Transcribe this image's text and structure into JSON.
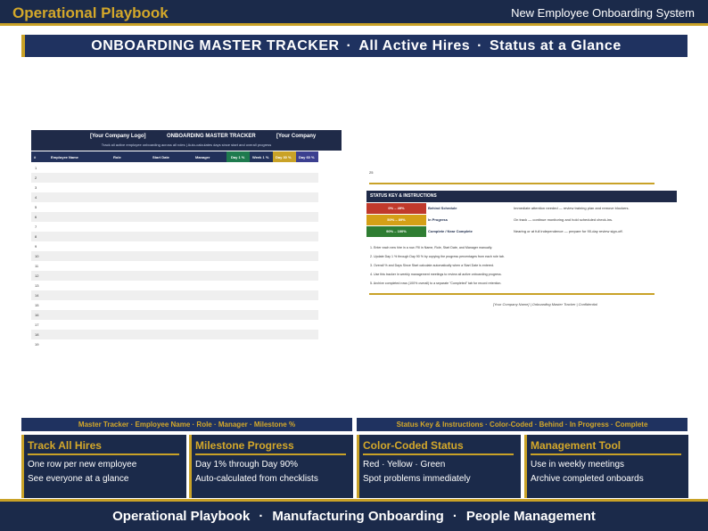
{
  "header": {
    "brand": "Operational Playbook",
    "system": "New Employee Onboarding System"
  },
  "banner": {
    "part1": "ONBOARDING MASTER TRACKER",
    "sep": "·",
    "part2": "All Active Hires",
    "part3": "Status at a Glance"
  },
  "sheet": {
    "logo_left": "[Your Company Logo]",
    "title": "ONBOARDING MASTER TRACKER",
    "logo_right": "[Your Company",
    "subtitle": "Track all active employee onboarding across all roles  |  Auto-calculates days since start and overall progress",
    "columns": [
      "#",
      "Employee Name",
      "Role",
      "Start Date",
      "Manager",
      "Day 1 %",
      "Week 1 %",
      "Day 30 %",
      "Day 60 %"
    ],
    "row_numbers": [
      "1",
      "2",
      "3",
      "4",
      "5",
      "6",
      "7",
      "8",
      "9",
      "10",
      "11",
      "12",
      "13",
      "14",
      "15",
      "16",
      "17",
      "18",
      "19"
    ]
  },
  "status_key": {
    "year": "25",
    "header": "STATUS KEY & INSTRUCTIONS",
    "rows": [
      {
        "range": "0% – 49%",
        "name": "Behind Schedule",
        "desc": "Immediate attention needed — review training plan and remove blockers.",
        "color": "#c0392b"
      },
      {
        "range": "50% – 89%",
        "name": "In Progress",
        "desc": "On track — continue monitoring and hold scheduled check-ins.",
        "color": "#d4a017"
      },
      {
        "range": "90% – 100%",
        "name": "Complete / Near Complete",
        "desc": "Nearing or at full independence — prepare for 90-day review sign-off.",
        "color": "#2e7d32"
      }
    ],
    "instructions": [
      "1.  Enter each new hire in a row. Fill in Name, Role, Start Date, and Manager manually.",
      "2.  Update Day 1 % through Day 90 % by copying the progress percentages from each role tab.",
      "3.  Overall % and Days Since Start calculate automatically when a Start Date is entered.",
      "4.  Use this tracker in weekly management meetings to review all active onboarding progress.",
      "5.  Archive completed rows (100% overall) to a separate \"Completed\" tab for record retention."
    ],
    "footer": "[Your Company Name]  |  Onboarding Master Tracker  |  Confidential"
  },
  "tagbars": {
    "left": "Master Tracker · Employee Name · Role · Manager · Milestone %",
    "right": "Status Key & Instructions · Color-Coded · Behind · In Progress · Complete"
  },
  "cards": [
    {
      "title": "Track All Hires",
      "l1": "One row per new employee",
      "l2": "See everyone at a glance"
    },
    {
      "title": "Milestone Progress",
      "l1": "Day 1% through Day 90%",
      "l2": "Auto-calculated from checklists"
    },
    {
      "title": "Color-Coded Status",
      "l1": "Red · Yellow · Green",
      "l2": "Spot problems immediately"
    },
    {
      "title": "Management Tool",
      "l1": "Use in weekly meetings",
      "l2": "Archive completed onboards"
    }
  ],
  "footer": {
    "p1": "Operational Playbook",
    "sep": "·",
    "p2": "Manufacturing Onboarding",
    "p3": "People Management"
  },
  "colors": {
    "navy": "#1b2a4a",
    "gold": "#c9a227",
    "day1": "#1e7a4e",
    "week1": "#1f3260",
    "day30": "#c9a227",
    "day60": "#3b3f8f"
  }
}
